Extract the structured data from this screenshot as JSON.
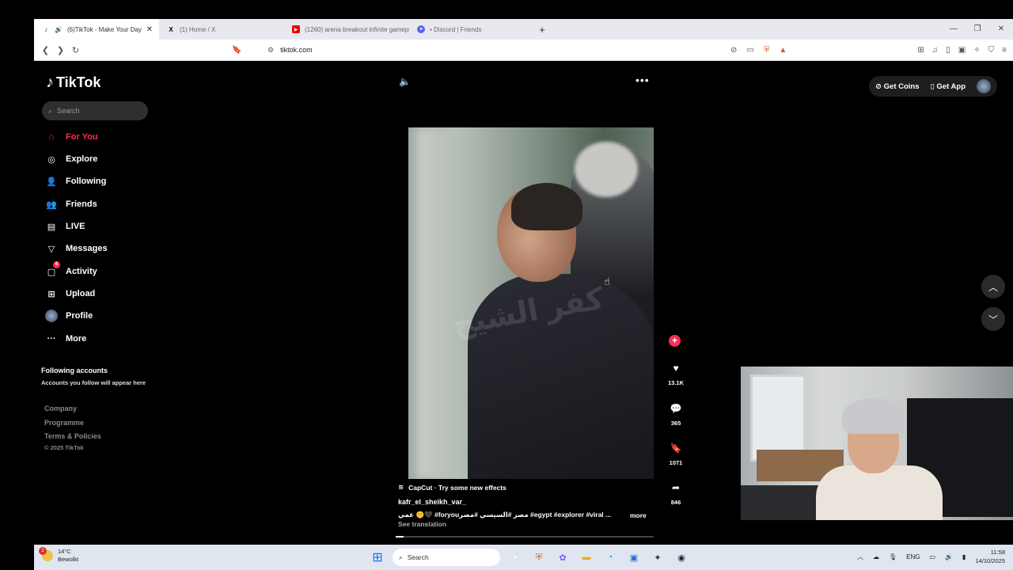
{
  "browser": {
    "tabs": [
      {
        "title": "(6)TikTok - Make Your Day",
        "favicon": "tiktok-icon",
        "active": true
      },
      {
        "title": "(1) Home / X",
        "favicon": "x-icon",
        "active": false
      },
      {
        "title": "(1260) arena breakout infinite gamepl",
        "favicon": "youtube-icon",
        "active": false
      },
      {
        "title": "• Discord | Friends",
        "favicon": "discord-icon",
        "active": false
      }
    ],
    "url": "tiktok.com"
  },
  "sidebar": {
    "logo": "TikTok",
    "search_placeholder": "Search",
    "items": [
      {
        "label": "For You",
        "icon": "home-icon",
        "active": true
      },
      {
        "label": "Explore",
        "icon": "compass-icon"
      },
      {
        "label": "Following",
        "icon": "following-icon"
      },
      {
        "label": "Friends",
        "icon": "friends-icon"
      },
      {
        "label": "LIVE",
        "icon": "live-icon"
      },
      {
        "label": "Messages",
        "icon": "messages-icon"
      },
      {
        "label": "Activity",
        "icon": "activity-icon",
        "badge": "6"
      },
      {
        "label": "Upload",
        "icon": "upload-icon"
      },
      {
        "label": "Profile",
        "icon": "avatar"
      },
      {
        "label": "More",
        "icon": "more-icon"
      }
    ],
    "following_title": "Following accounts",
    "following_sub": "Accounts you follow will appear here",
    "footer_links": [
      "Company",
      "Programme",
      "Terms & Policies"
    ],
    "copyright": "© 2025 TikTok"
  },
  "topright": {
    "coins": "Get Coins",
    "app": "Get App"
  },
  "video": {
    "capcut": "CapCut · Try some new effects",
    "author": "kafr_el_sheikh_var_",
    "caption": "عمي 🤫🖤 #foryouمصر #السيسي #مصر #egypt #explorer #viral ...",
    "more": "more",
    "translate": "See translation",
    "watermark": "كفر الشيخ",
    "progress": 0.03,
    "actions": [
      {
        "icon": "heart-icon",
        "count": "13.1K"
      },
      {
        "icon": "comment-icon",
        "count": "365"
      },
      {
        "icon": "bookmark-icon",
        "count": "1071"
      },
      {
        "icon": "share-icon",
        "count": "846"
      }
    ]
  },
  "taskbar": {
    "weather_temp": "14°C",
    "weather_desc": "Bewolkt",
    "weather_badge": "2",
    "search": "Search",
    "lang": "ENG",
    "time": "11:58",
    "date": "14/10/2025"
  }
}
